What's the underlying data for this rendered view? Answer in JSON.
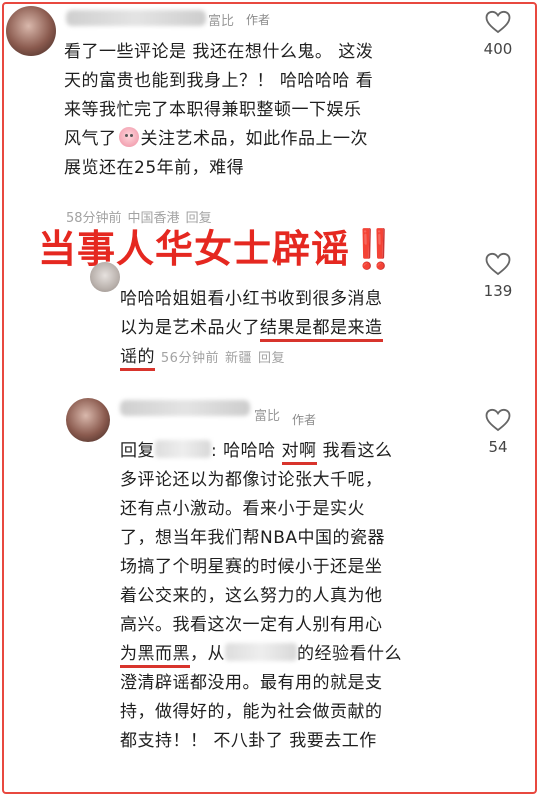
{
  "overlay": {
    "headline": "当事人华女士辟谣‼️"
  },
  "comments": [
    {
      "name_tail": "富比",
      "author_tag": "作者",
      "lines": [
        "看了一些评论是 我还在想什么鬼。 这泼",
        "天的富贵也能到我身上？！ 哈哈哈哈 看",
        "来等我忙完了本职得兼职整顿一下娱乐",
        "关注艺术品，如此作品上一次",
        "展览还在25年前，难得"
      ],
      "line4_prefix": "风气了",
      "time": "58分钟前",
      "location": "中国香港",
      "reply": "回复",
      "likes": "400"
    },
    {
      "lines": [
        "哈哈哈姐姐看小红书收到很多消息",
        "以为是艺术品火了",
        "结果是都是来造",
        "谣的"
      ],
      "time": "56分钟前",
      "location": "新疆",
      "reply": "回复",
      "likes": "139"
    },
    {
      "name_tail": "富比",
      "author_tag": "作者",
      "reply_prefix": "回复",
      "l1_a": ": 哈哈哈",
      "l1_b": "对啊",
      "l1_c": "我看这么",
      "lines": [
        "多评论还以为都像讨论张大千呢，",
        "还有点小激动。看来小于是实火",
        "了，想当年我们帮NBA中国的瓷器",
        "场搞了个明星赛的时候小于还是坐",
        "着公交来的，这么努力的人真为他",
        "高兴。我看这次一定有人别有用心"
      ],
      "l8_a": "为黑而黑",
      "l8_b": "，从",
      "l8_c": "的经验看什么",
      "tail_lines": [
        "澄清辟谣都没用。最有用的就是支",
        "持，做得好的，能为社会做贡献的",
        "都支持！！ 不八卦了 我要去工作"
      ],
      "likes": "54"
    }
  ]
}
